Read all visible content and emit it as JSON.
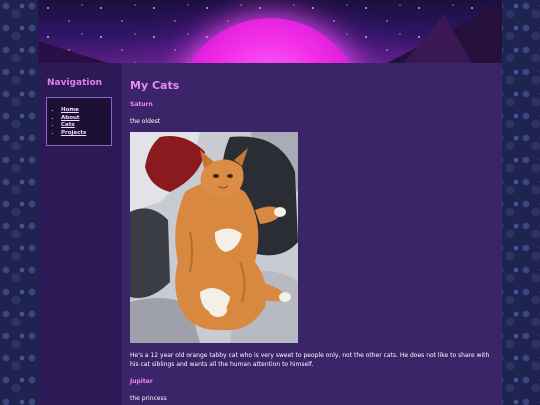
{
  "sidebar": {
    "title": "Navigation",
    "items": [
      {
        "label": "Home"
      },
      {
        "label": "About"
      },
      {
        "label": "Cats"
      },
      {
        "label": "Projects"
      }
    ]
  },
  "main": {
    "title": "My Cats",
    "cats": [
      {
        "name": "Saturn",
        "tagline": "the oldest",
        "description": "He's a 12 year old orange tabby cat who is very sweet to people only, not the other cats. He does not like to share with his cat siblings and wants all the human attention to himself."
      },
      {
        "name": "Jupiter",
        "tagline": "the princess"
      }
    ]
  },
  "colors": {
    "accent": "#e98af4",
    "content_bg": "#3b2468",
    "sidebar_bg": "#2c1a56",
    "sun": "#f22ce6"
  },
  "icons": {
    "header_banner": "synthwave-sunset-banner",
    "nav_bullet": "bullet-dot"
  }
}
